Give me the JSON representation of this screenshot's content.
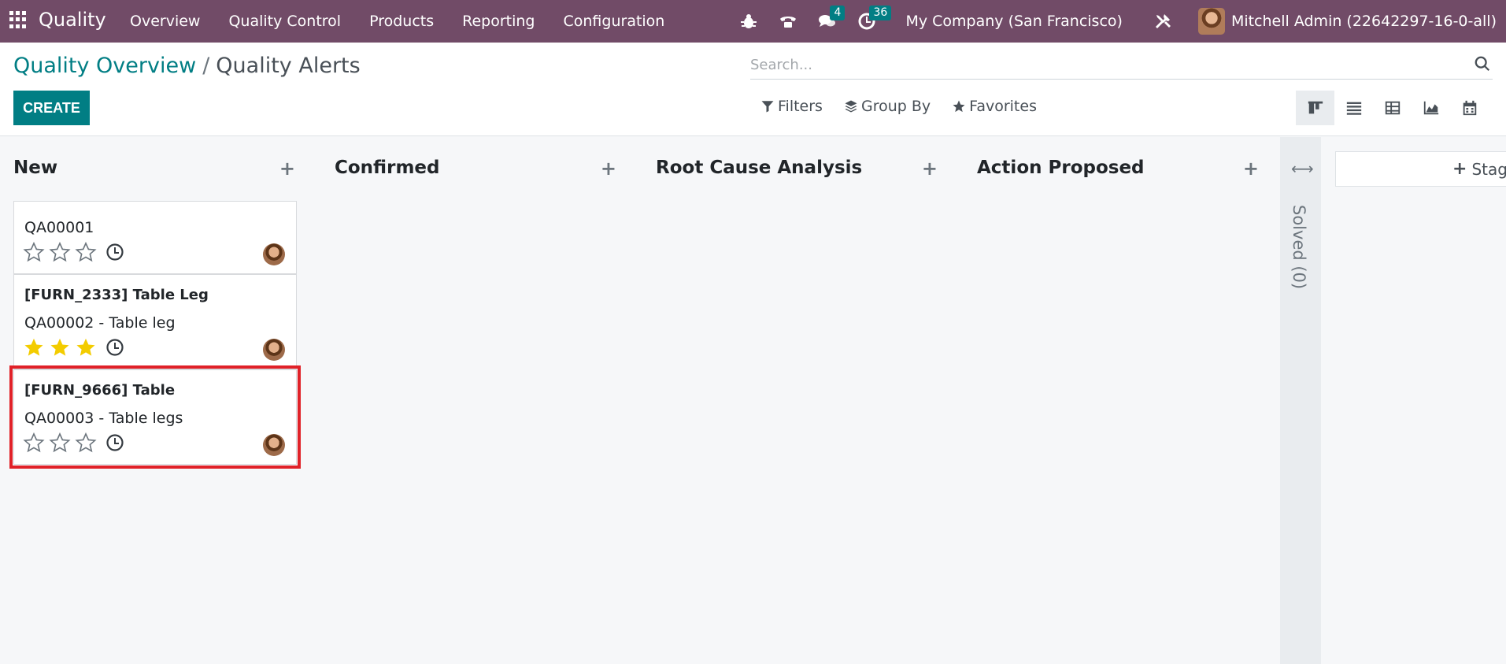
{
  "navbar": {
    "app_name": "Quality",
    "menu": [
      "Overview",
      "Quality Control",
      "Products",
      "Reporting",
      "Configuration"
    ],
    "messages_count": "4",
    "activities_count": "36",
    "company": "My Company (San Francisco)",
    "user": "Mitchell Admin (22642297-16-0-all)"
  },
  "breadcrumb": {
    "parent": "Quality Overview",
    "separator": "/",
    "current": "Quality Alerts"
  },
  "actions": {
    "create": "CREATE"
  },
  "search": {
    "placeholder": "Search..."
  },
  "filters": {
    "filters": "Filters",
    "group_by": "Group By",
    "favorites": "Favorites"
  },
  "columns": [
    {
      "title": "New",
      "cards": [
        {
          "title": "",
          "subtitle": "QA00001",
          "stars": 0,
          "selected": false
        },
        {
          "title": "[FURN_2333] Table Leg",
          "subtitle": "QA00002 - Table leg",
          "stars": 3,
          "selected": false
        },
        {
          "title": "[FURN_9666] Table",
          "subtitle": "QA00003 - Table legs",
          "stars": 0,
          "selected": true
        }
      ]
    },
    {
      "title": "Confirmed",
      "cards": []
    },
    {
      "title": "Root Cause Analysis",
      "cards": []
    },
    {
      "title": "Action Proposed",
      "cards": []
    }
  ],
  "folded_column": {
    "label": "Solved (0)"
  },
  "add_stage": "Stage",
  "colors": {
    "navbar": "#714b67",
    "primary": "#017e84",
    "star": "#f3cc00",
    "highlight": "#e02128"
  }
}
